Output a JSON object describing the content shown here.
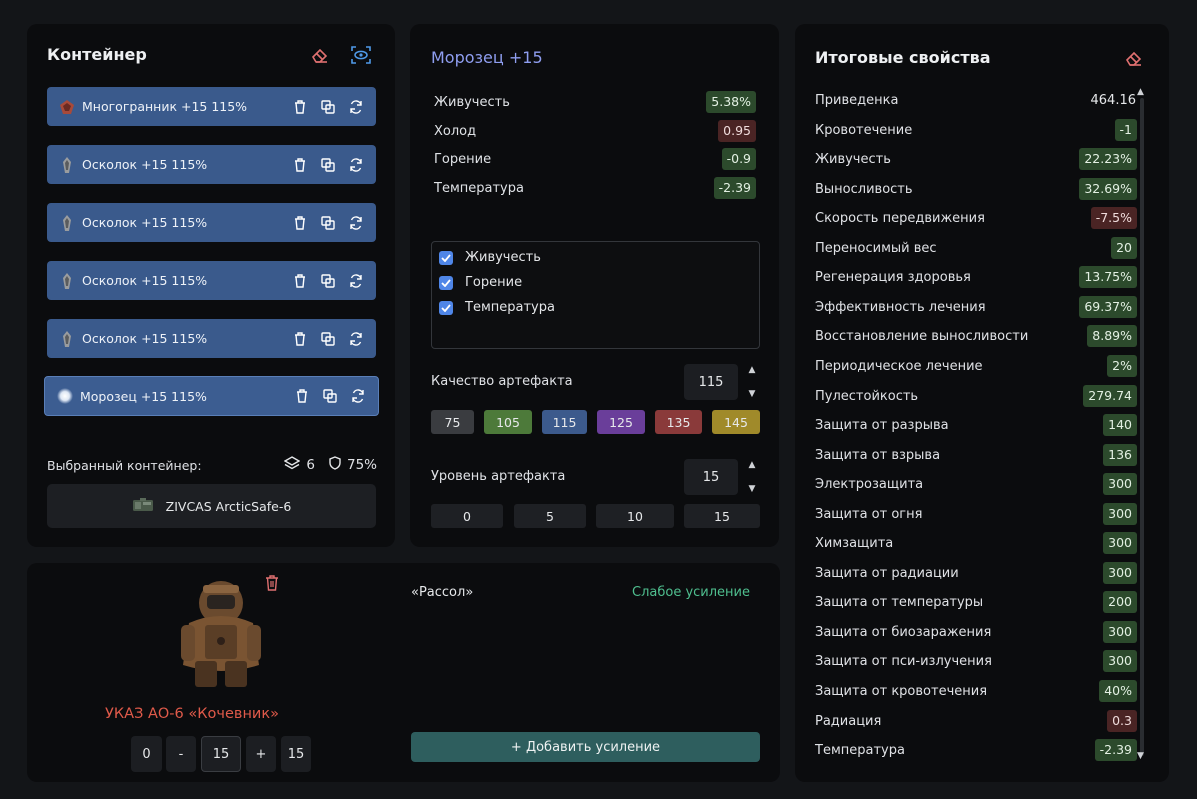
{
  "container": {
    "title": "Контейнер",
    "slots": [
      {
        "label": "Многогранник +15 115%",
        "icon": "polyhedron-icon"
      },
      {
        "label": "Осколок +15 115%",
        "icon": "shard-icon"
      },
      {
        "label": "Осколок +15 115%",
        "icon": "shard-icon"
      },
      {
        "label": "Осколок +15 115%",
        "icon": "shard-icon"
      },
      {
        "label": "Осколок +15 115%",
        "icon": "shard-icon"
      },
      {
        "label": "Морозец +15 115%",
        "icon": "frost-icon"
      }
    ],
    "selected_label": "Выбранный контейнер:",
    "slot_count": "6",
    "protection": "75%",
    "container_name": "ZIVCAS ArcticSafe-6"
  },
  "artifact": {
    "title": "Морозец +15",
    "props": [
      {
        "name": "Живучесть",
        "value": "5.38%",
        "tone": "g"
      },
      {
        "name": "Холод",
        "value": "0.95",
        "tone": "r"
      },
      {
        "name": "Горение",
        "value": "-0.9",
        "tone": "g"
      },
      {
        "name": "Температура",
        "value": "-2.39",
        "tone": "g"
      }
    ],
    "checks": [
      "Живучесть",
      "Горение",
      "Температура"
    ],
    "quality_label": "Качество артефакта",
    "quality_value": "115",
    "quality_chips": [
      "75",
      "105",
      "115",
      "125",
      "135",
      "145"
    ],
    "level_label": "Уровень артефакта",
    "level_value": "15",
    "level_chips": [
      "0",
      "5",
      "10",
      "15"
    ]
  },
  "summary": {
    "title": "Итоговые свойства",
    "rows": [
      {
        "name": "Приведенка",
        "value": "464.16",
        "tone": "plain"
      },
      {
        "name": "Кровотечение",
        "value": "-1",
        "tone": "g"
      },
      {
        "name": "Живучесть",
        "value": "22.23%",
        "tone": "g"
      },
      {
        "name": "Выносливость",
        "value": "32.69%",
        "tone": "g"
      },
      {
        "name": "Скорость передвижения",
        "value": "-7.5%",
        "tone": "r"
      },
      {
        "name": "Переносимый вес",
        "value": "20",
        "tone": "g"
      },
      {
        "name": "Регенерация здоровья",
        "value": "13.75%",
        "tone": "g"
      },
      {
        "name": "Эффективность лечения",
        "value": "69.37%",
        "tone": "g"
      },
      {
        "name": "Восстановление выносливости",
        "value": "8.89%",
        "tone": "g"
      },
      {
        "name": "Периодическое лечение",
        "value": "2%",
        "tone": "g"
      },
      {
        "name": "Пулестойкость",
        "value": "279.74",
        "tone": "g"
      },
      {
        "name": "Защита от разрыва",
        "value": "140",
        "tone": "g"
      },
      {
        "name": "Защита от взрыва",
        "value": "136",
        "tone": "g"
      },
      {
        "name": "Электрозащита",
        "value": "300",
        "tone": "g"
      },
      {
        "name": "Защита от огня",
        "value": "300",
        "tone": "g"
      },
      {
        "name": "Химзащита",
        "value": "300",
        "tone": "g"
      },
      {
        "name": "Защита от радиации",
        "value": "300",
        "tone": "g"
      },
      {
        "name": "Защита от температуры",
        "value": "200",
        "tone": "g"
      },
      {
        "name": "Защита от биозаражения",
        "value": "300",
        "tone": "g"
      },
      {
        "name": "Защита от пси-излучения",
        "value": "300",
        "tone": "g"
      },
      {
        "name": "Защита от кровотечения",
        "value": "40%",
        "tone": "g"
      },
      {
        "name": "Радиация",
        "value": "0.3",
        "tone": "r"
      },
      {
        "name": "Температура",
        "value": "-2.39",
        "tone": "g"
      }
    ]
  },
  "suit": {
    "name": "УКАЗ АО-6 «Кочевник»",
    "stepper": {
      "min": "0",
      "minus": "-",
      "value": "15",
      "plus": "+",
      "max": "15"
    },
    "boost_name": "«Рассол»",
    "boost_type": "Слабое усиление",
    "add_label": "+ Добавить усиление"
  },
  "colors": {
    "slot_bg": "#3a5a8c",
    "chip_75": "#3a3c40",
    "chip_105": "#4d7a3a",
    "chip_115": "#3c5a8c",
    "chip_125": "#6a3e9a",
    "chip_135": "#8a3a3a",
    "chip_145": "#a08a2a"
  }
}
